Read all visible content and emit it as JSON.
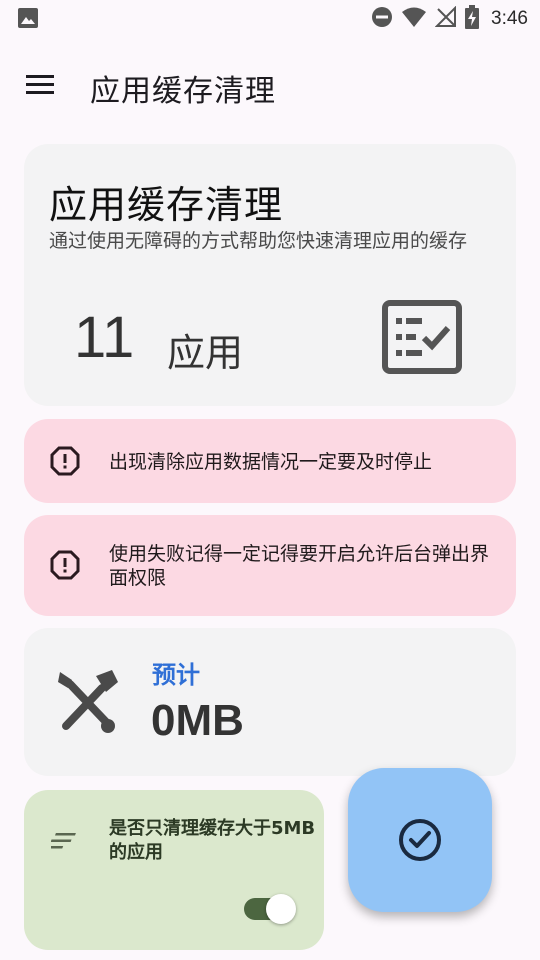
{
  "status_bar": {
    "time": "3:46",
    "icons": [
      "image-icon",
      "do-not-disturb-icon",
      "wifi-icon",
      "no-signal-icon",
      "battery-charging-icon"
    ]
  },
  "app_bar": {
    "title": "应用缓存清理",
    "menu_icon": "menu-icon"
  },
  "hero": {
    "title": "应用缓存清理",
    "subtitle": "通过使用无障碍的方式帮助您快速清理应用的缓存",
    "count": "11",
    "count_unit": "应用",
    "icon": "checklist-icon"
  },
  "warnings": [
    {
      "icon": "warning-octagon-icon",
      "text": "出现清除应用数据情况一定要及时停止"
    },
    {
      "icon": "warning-octagon-icon",
      "text": "使用失败记得一定记得要开启允许后台弹出界面权限"
    }
  ],
  "estimate": {
    "icon": "tools-icon",
    "label": "预计",
    "value": "0MB"
  },
  "filter": {
    "icon": "sort-icon",
    "label": "是否只清理缓存大于5MB 的应用",
    "toggle_on": true
  },
  "fab": {
    "icon": "check-circle-icon"
  },
  "colors": {
    "background": "#fcf8fc",
    "warning_card": "#fcd9e3",
    "estimate_label": "#2f6fd6",
    "filter_card": "#dbe8cd",
    "fab": "#92c4f6"
  }
}
